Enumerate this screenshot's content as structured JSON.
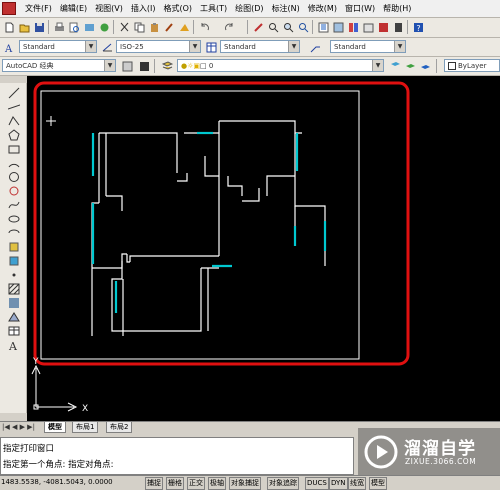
{
  "menu": [
    "文件(F)",
    "编辑(E)",
    "视图(V)",
    "插入(I)",
    "格式(O)",
    "工具(T)",
    "绘图(D)",
    "标注(N)",
    "修改(M)",
    "窗口(W)",
    "帮助(H)"
  ],
  "toolbar2": {
    "text_style": "Standard",
    "dim_style": "ISO-25",
    "table_style": "Standard",
    "multileader_style": "Standard"
  },
  "toolbar3": {
    "workspace": "AutoCAD 经典",
    "layer": "0",
    "color_control": "ByLayer"
  },
  "drawing": {
    "highlight_color": "#e01010",
    "wall_color": "#ffffff",
    "window_color": "#00c8d0",
    "axis_x_label": "X",
    "axis_y_label": "Y"
  },
  "tabs": [
    "模型",
    "布局1",
    "布局2"
  ],
  "command": {
    "line1": "指定打印窗口",
    "line2": "指定第一个角点: 指定对角点:"
  },
  "status": {
    "coords": "1483.5538, -4081.5043, 0.0000",
    "buttons": [
      "捕捉",
      "栅格",
      "正交",
      "极轴",
      "对象捕捉",
      "对象追踪",
      "DUCS",
      "DYN",
      "线宽",
      "模型"
    ]
  },
  "watermark": {
    "title": "溜溜自学",
    "url": "ZIXUE.3066.COM"
  }
}
